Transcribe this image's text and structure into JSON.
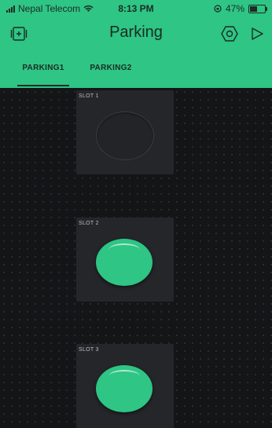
{
  "status_bar": {
    "carrier": "Nepal Telecom",
    "time": "8:13 PM",
    "battery": "47%"
  },
  "header": {
    "title": "Parking"
  },
  "tabs": [
    {
      "label": "PARKING1",
      "active": true
    },
    {
      "label": "PARKING2",
      "active": false
    }
  ],
  "slots": [
    {
      "label": "SLOT 1",
      "state": "off"
    },
    {
      "label": "SLOT 2",
      "state": "on"
    },
    {
      "label": "SLOT 3",
      "state": "on"
    }
  ],
  "colors": {
    "accent": "#2ec585",
    "background": "#121315",
    "tile": "#242629"
  }
}
